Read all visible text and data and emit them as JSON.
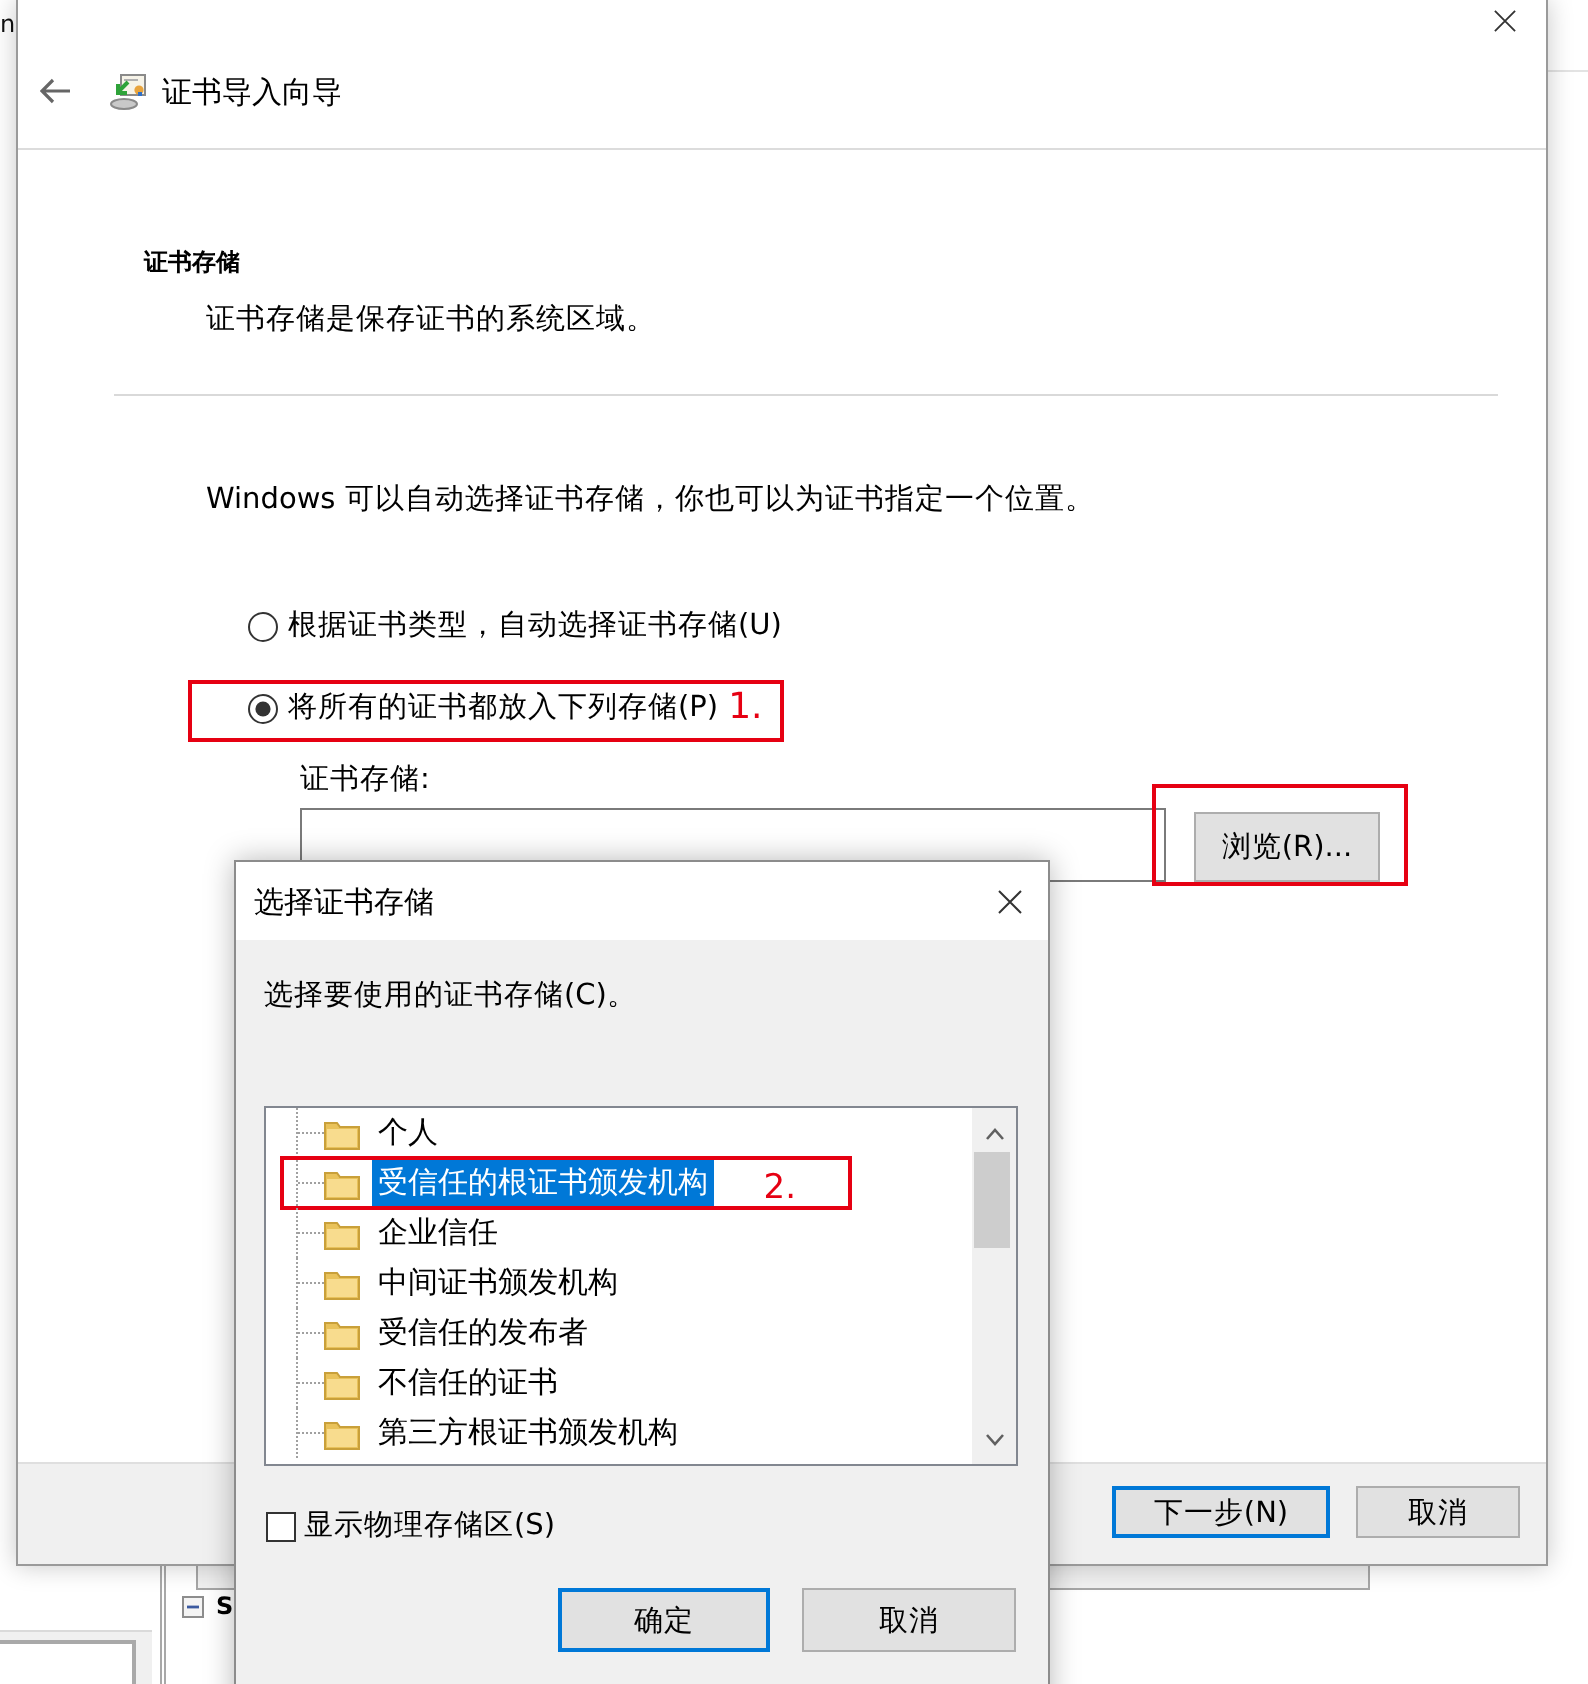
{
  "background": {
    "corner_text": "n",
    "tree_node": {
      "label": "S",
      "expanded": true
    }
  },
  "wizard": {
    "title": "证书导入向导",
    "section_title": "证书存储",
    "section_description": "证书存储是保存证书的系统区域。",
    "intro": "Windows 可以自动选择证书存储，你也可以为证书指定一个位置。",
    "options": [
      {
        "label": "根据证书类型，自动选择证书存储(U)",
        "selected": false
      },
      {
        "label": "将所有的证书都放入下列存储(P)",
        "selected": true,
        "annotation": "1."
      }
    ],
    "store_field": {
      "label": "证书存储:"
    },
    "browse_button": {
      "label": "浏览(R)...",
      "annotated": true
    },
    "buttons": [
      {
        "label": "下一步(N)",
        "default": true
      },
      {
        "label": "取消",
        "default": false
      }
    ]
  },
  "dialog": {
    "title": "选择证书存储",
    "prompt": "选择要使用的证书存储(C)。",
    "stores": [
      {
        "label": "个人",
        "selected": false
      },
      {
        "label": "受信任的根证书颁发机构",
        "selected": true,
        "annotation": "2."
      },
      {
        "label": "企业信任",
        "selected": false
      },
      {
        "label": "中间证书颁发机构",
        "selected": false
      },
      {
        "label": "受信任的发布者",
        "selected": false
      },
      {
        "label": "不信任的证书",
        "selected": false
      },
      {
        "label": "第三方根证书颁发机构",
        "selected": false
      }
    ],
    "show_physical_stores": {
      "label": "显示物理存储区(S)",
      "checked": false
    },
    "buttons": [
      {
        "label": "确定",
        "default": true
      },
      {
        "label": "取消",
        "default": false
      }
    ]
  }
}
